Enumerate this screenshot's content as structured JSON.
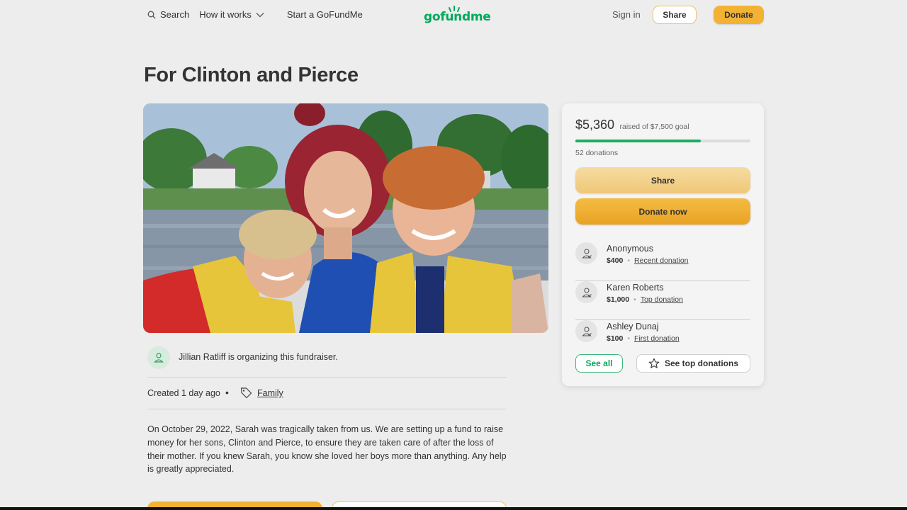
{
  "header": {
    "search_label": "Search",
    "how_label": "How it works",
    "start_label": "Start a GoFundMe",
    "logo_text": "gofundme",
    "signin_label": "Sign in",
    "share_label": "Share",
    "donate_label": "Donate"
  },
  "campaign": {
    "title": "For Clinton and Pierce",
    "organizer_text": "Jillian Ratliff is organizing this fundraiser.",
    "created": "Created 1 day ago",
    "category": "Family",
    "story": "On October 29, 2022, Sarah was tragically taken from us. We are setting up a fund to raise money for her sons, Clinton and Pierce, to ensure they are taken care of after the loss of their mother. If you knew Sarah, you know she loved her boys more than anything. Any help is greatly appreciated."
  },
  "sidebar": {
    "raised": "$5,360",
    "goal_text": "raised of $7,500 goal",
    "progress_fraction": 0.715,
    "donations_count": "52 donations",
    "share_label": "Share",
    "donate_label": "Donate now",
    "donors": [
      {
        "name": "Anonymous",
        "amount": "$400",
        "tag": "Recent donation"
      },
      {
        "name": "Karen Roberts",
        "amount": "$1,000",
        "tag": "Top donation"
      },
      {
        "name": "Ashley Dunaj",
        "amount": "$100",
        "tag": "First donation"
      }
    ],
    "see_all_label": "See all",
    "see_top_label": "See top donations"
  },
  "colors": {
    "brand_green": "#02a95c",
    "donate_orange": "#f2b233",
    "background": "#ededed"
  }
}
